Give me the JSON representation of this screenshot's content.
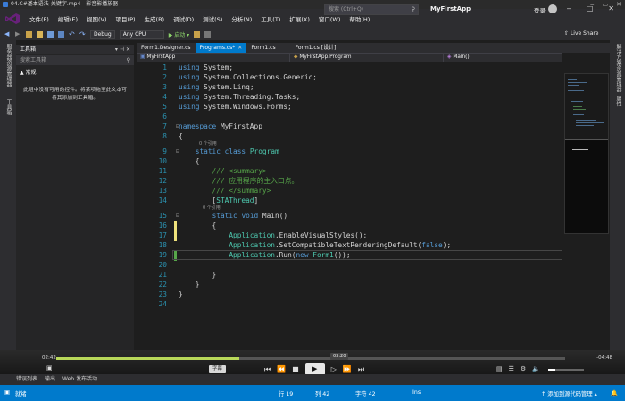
{
  "player": {
    "title": "04.C#基本语法-关键字.mp4 - 影音影播放器",
    "window_buttons": [
      "‒",
      "▭",
      "✕"
    ]
  },
  "menubar": {
    "items": [
      "文件(F)",
      "编辑(E)",
      "视图(V)",
      "项目(P)",
      "生成(B)",
      "调试(D)",
      "测试(S)",
      "分析(N)",
      "工具(T)",
      "扩展(X)",
      "窗口(W)",
      "帮助(H)"
    ],
    "search_placeholder": "搜索 (Ctrl+Q)",
    "app_name": "MyFirstApp",
    "login": "登录",
    "window_buttons": [
      "‒",
      "□",
      "✕"
    ]
  },
  "toolbar": {
    "config": "Debug",
    "platform": "Any CPU",
    "start": "▶ 启动 ▾",
    "liveshare": "Live Share"
  },
  "left_strip": {
    "items": [
      "服务器资源管理器",
      "工具箱"
    ]
  },
  "right_strip": {
    "items": [
      "解决方案资源管理器",
      "属性"
    ]
  },
  "toolbox": {
    "title": "工具箱",
    "search_placeholder": "搜索工具箱",
    "group": "▲ 常规",
    "empty_text": "此组中没有可用的控件。将某项拖至此文本可将其添加到工具箱。"
  },
  "tabs": [
    {
      "label": "Form1.Designer.cs",
      "active": false
    },
    {
      "label": "Programs.cs*",
      "active": true
    },
    {
      "label": "Form1.cs",
      "active": false
    },
    {
      "label": "Form1.cs [设计]",
      "active": false
    }
  ],
  "navbar": {
    "project": "MyFirstApp",
    "class": "MyFirstApp.Program",
    "member": "Main()"
  },
  "code": {
    "ref_labels": {
      "class": "0 个引用",
      "method": "0 个引用"
    },
    "lines": [
      {
        "n": "1",
        "t": "using System;"
      },
      {
        "n": "2",
        "t": "using System.Collections.Generic;"
      },
      {
        "n": "3",
        "t": "using System.Linq;"
      },
      {
        "n": "4",
        "t": "using System.Threading.Tasks;"
      },
      {
        "n": "5",
        "t": "using System.Windows.Forms;"
      },
      {
        "n": "6",
        "t": ""
      },
      {
        "n": "7",
        "t": "namespace MyFirstApp"
      },
      {
        "n": "8",
        "t": "{"
      },
      {
        "n": "9",
        "t": "    static class Program"
      },
      {
        "n": "10",
        "t": "    {"
      },
      {
        "n": "11",
        "t": "        /// <summary>"
      },
      {
        "n": "12",
        "t": "        /// 应用程序的主入口点。"
      },
      {
        "n": "13",
        "t": "        /// </summary>"
      },
      {
        "n": "14",
        "t": "        [STAThread]"
      },
      {
        "n": "15",
        "t": "        static void Main()"
      },
      {
        "n": "16",
        "t": "        {"
      },
      {
        "n": "17",
        "t": "            Application.EnableVisualStyles();"
      },
      {
        "n": "18",
        "t": "            Application.SetCompatibleTextRenderingDefault(false);"
      },
      {
        "n": "19",
        "t": "            Application.Run(new Form1());"
      },
      {
        "n": "20",
        "t": ""
      },
      {
        "n": "21",
        "t": "        }"
      },
      {
        "n": "22",
        "t": "    }"
      },
      {
        "n": "23",
        "t": "}"
      },
      {
        "n": "24",
        "t": ""
      }
    ]
  },
  "video": {
    "current_time": "02:42",
    "remaining_time": "-04:48",
    "hover_time": "03:20",
    "progress_fraction": 0.36,
    "subtitle_label": "字幕",
    "volume_fraction": 0.2
  },
  "bottom_tabs": [
    "错误列表",
    "输出",
    "Web 发布活动"
  ],
  "status": {
    "ready": "就绪",
    "line": "行 19",
    "col": "列 42",
    "char": "字符 42",
    "mode": "Ins",
    "source_control": "↑ 添加到源代码管理 ▴"
  },
  "colors": {
    "accent": "#007acc",
    "progress": "#b9d95a",
    "change_saved": "#57a64a",
    "change_unsaved": "#efe27c"
  }
}
